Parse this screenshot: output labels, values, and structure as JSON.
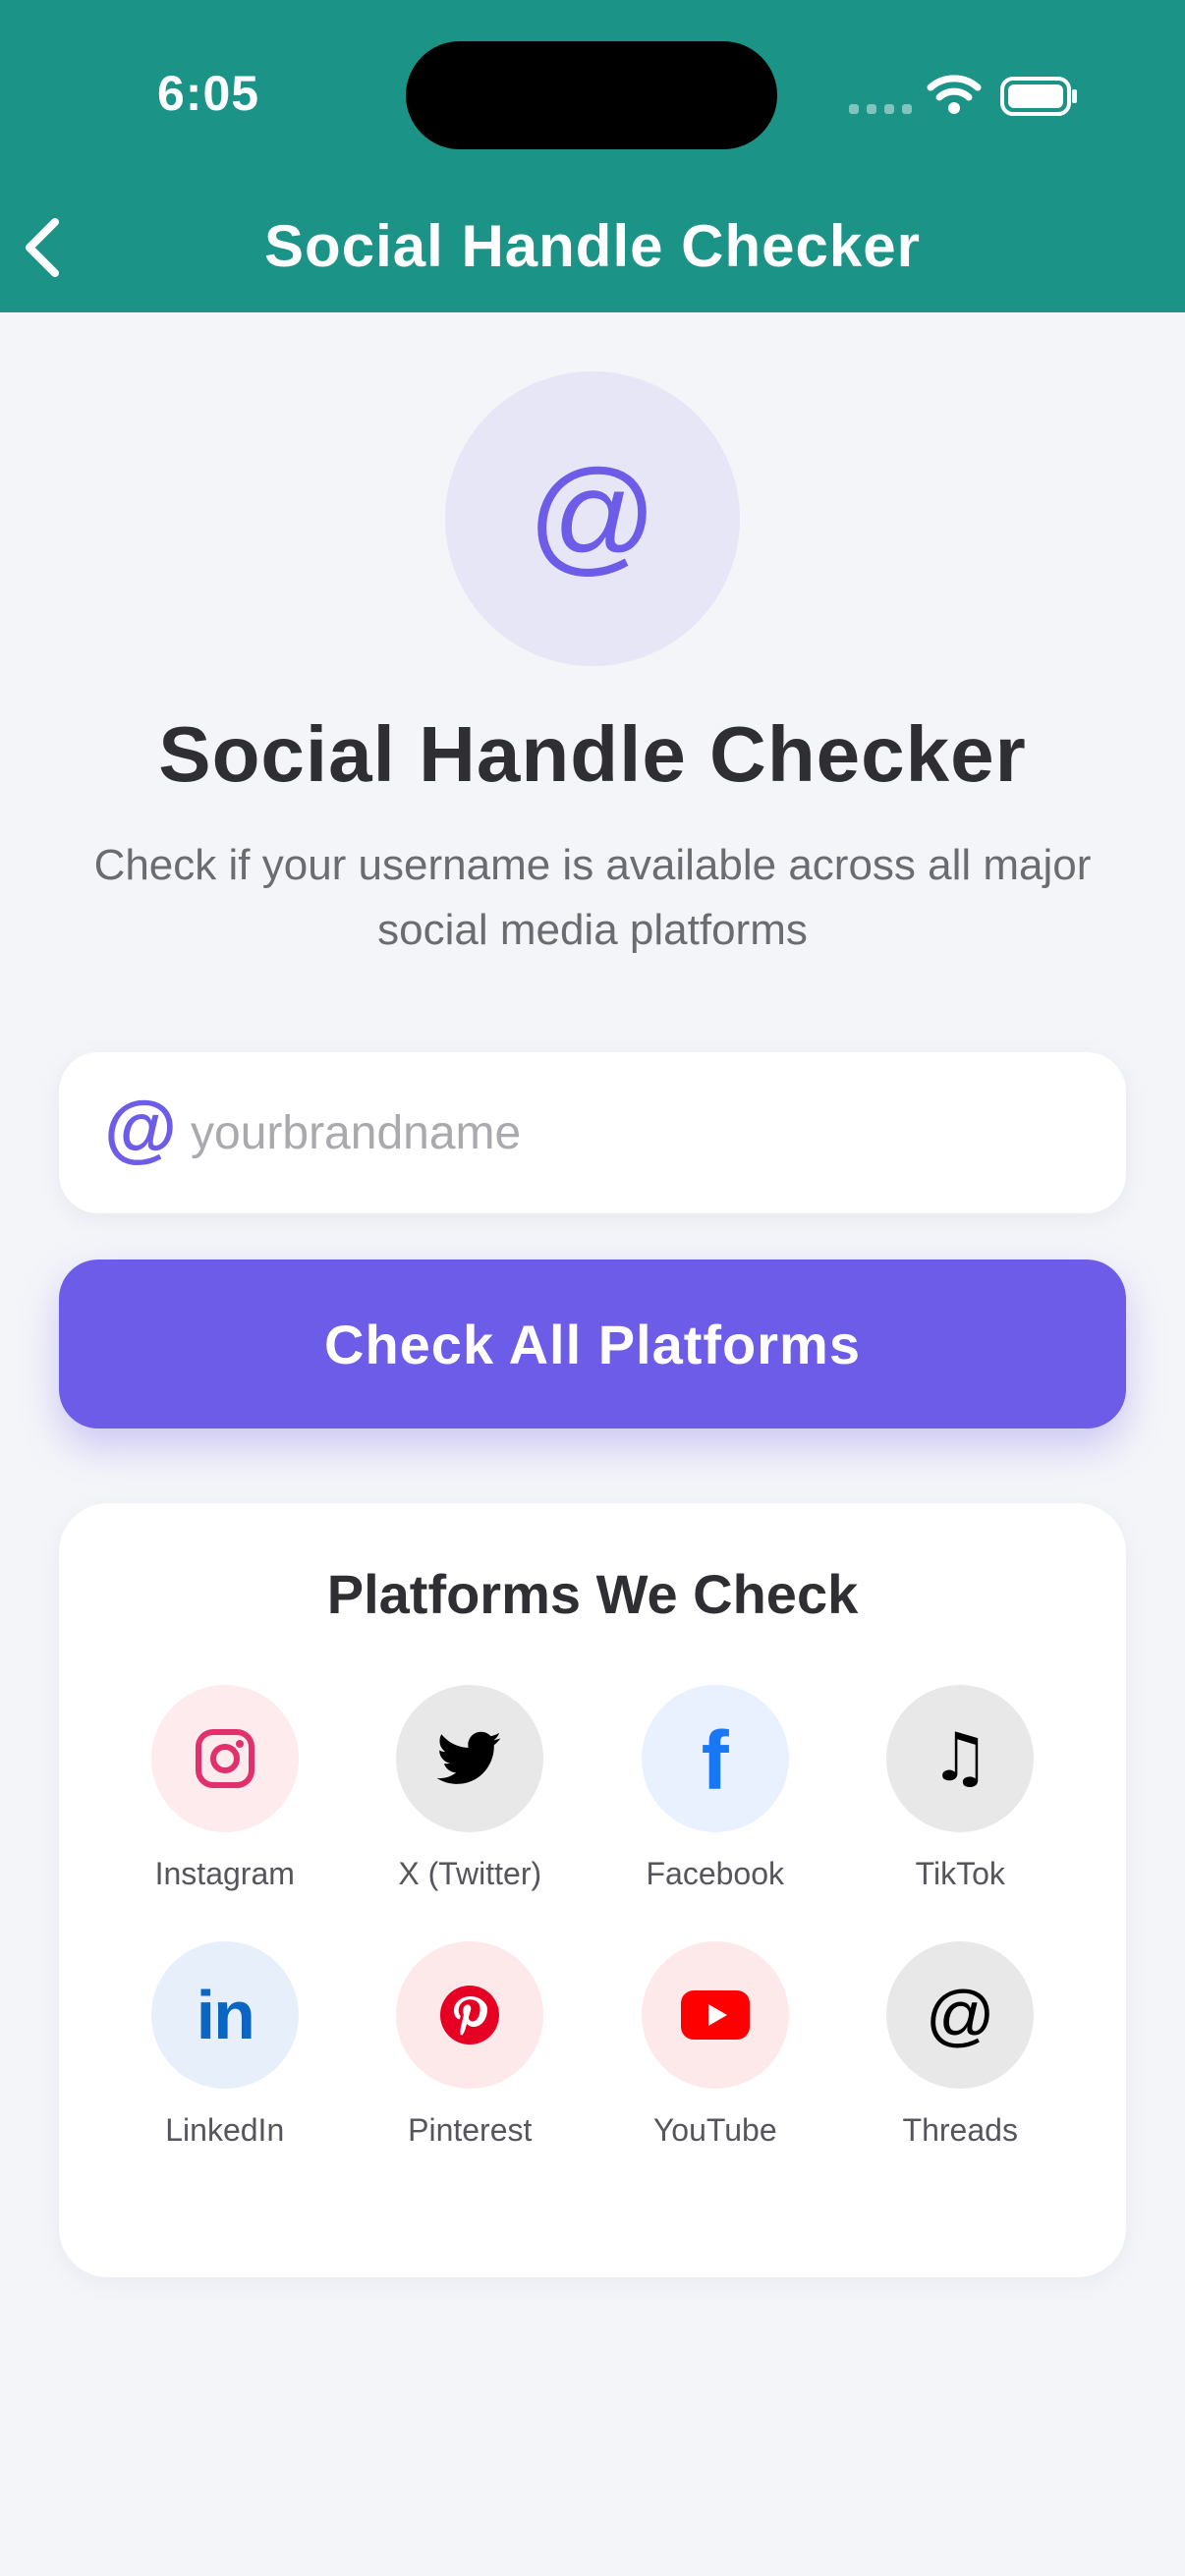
{
  "status_bar": {
    "time": "6:05"
  },
  "nav": {
    "title": "Social Handle Checker",
    "back_icon": "chevron-left-icon"
  },
  "hero": {
    "icon_glyph": "@",
    "title": "Social Handle Checker",
    "subtitle": "Check if your username is available across all major social media platforms"
  },
  "search": {
    "prefix": "@",
    "placeholder": "yourbrandname",
    "value": ""
  },
  "action": {
    "label": "Check All Platforms"
  },
  "platforms": {
    "title": "Platforms We Check",
    "items": [
      {
        "label": "Instagram",
        "icon": "instagram-icon",
        "bg": "#fdebee",
        "color": "#e1306c"
      },
      {
        "label": "X (Twitter)",
        "icon": "twitter-icon",
        "bg": "#e8e8e8",
        "color": "#000000"
      },
      {
        "label": "Facebook",
        "icon": "facebook-icon",
        "bg": "#e8f1fd",
        "color": "#1877f2"
      },
      {
        "label": "TikTok",
        "icon": "tiktok-icon",
        "bg": "#e8e8e8",
        "color": "#000000"
      },
      {
        "label": "LinkedIn",
        "icon": "linkedin-icon",
        "bg": "#e7f0fa",
        "color": "#0a66c2"
      },
      {
        "label": "Pinterest",
        "icon": "pinterest-icon",
        "bg": "#fde9ea",
        "color": "#e60023"
      },
      {
        "label": "YouTube",
        "icon": "youtube-icon",
        "bg": "#fde9e9",
        "color": "#ff0000"
      },
      {
        "label": "Threads",
        "icon": "threads-icon",
        "bg": "#e8e8e8",
        "color": "#000000"
      }
    ]
  },
  "colors": {
    "header": "#1b9387",
    "accent": "#6c5ce7",
    "background": "#f4f5f9"
  }
}
